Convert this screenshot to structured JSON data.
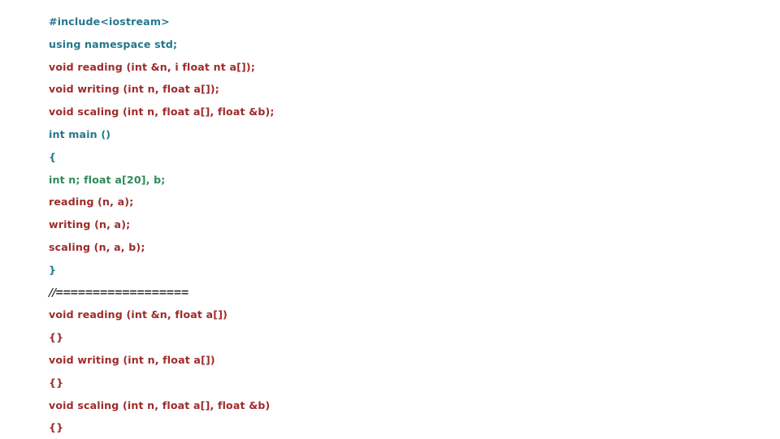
{
  "slide": {
    "background_color": "#ffffff",
    "language": "C++"
  },
  "palette": {
    "teal": "#24778c",
    "maroon": "#9e2b2b",
    "green": "#2e8b57",
    "black": "#000000"
  },
  "code": {
    "lines": [
      {
        "text": "#include<iostream>",
        "color_role": "teal",
        "style": "code"
      },
      {
        "text": "using namespace std;",
        "color_role": "teal",
        "style": "code"
      },
      {
        "text": "void reading (int &n, i float nt a[]);",
        "color_role": "maroon",
        "style": "code"
      },
      {
        "text": "void writing (int n, float a[]);",
        "color_role": "maroon",
        "style": "code"
      },
      {
        "text": "void scaling (int n, float a[], float &b);",
        "color_role": "maroon",
        "style": "code"
      },
      {
        "text": "int main ()",
        "color_role": "teal",
        "style": "code"
      },
      {
        "text": "{",
        "color_role": "teal",
        "style": "code"
      },
      {
        "text": "int n; float a[20], b;",
        "color_role": "green",
        "style": "code"
      },
      {
        "text": "reading (n, a);",
        "color_role": "maroon",
        "style": "code"
      },
      {
        "text": "writing (n, a);",
        "color_role": "maroon",
        "style": "code"
      },
      {
        "text": "scaling (n, a, b);",
        "color_role": "maroon",
        "style": "code"
      },
      {
        "text": "}",
        "color_role": "teal",
        "style": "code"
      },
      {
        "text": "//==================",
        "color_role": "black",
        "style": "divider"
      },
      {
        "text": "void reading (int &n, float a[])",
        "color_role": "maroon",
        "style": "code"
      },
      {
        "text": "{}",
        "color_role": "maroon",
        "style": "code"
      },
      {
        "text": "void writing (int n, float a[])",
        "color_role": "maroon",
        "style": "code"
      },
      {
        "text": "{}",
        "color_role": "maroon",
        "style": "code"
      },
      {
        "text": "void scaling (int n, float a[], float &b)",
        "color_role": "maroon",
        "style": "code"
      },
      {
        "text": "{}",
        "color_role": "maroon",
        "style": "code"
      }
    ]
  }
}
